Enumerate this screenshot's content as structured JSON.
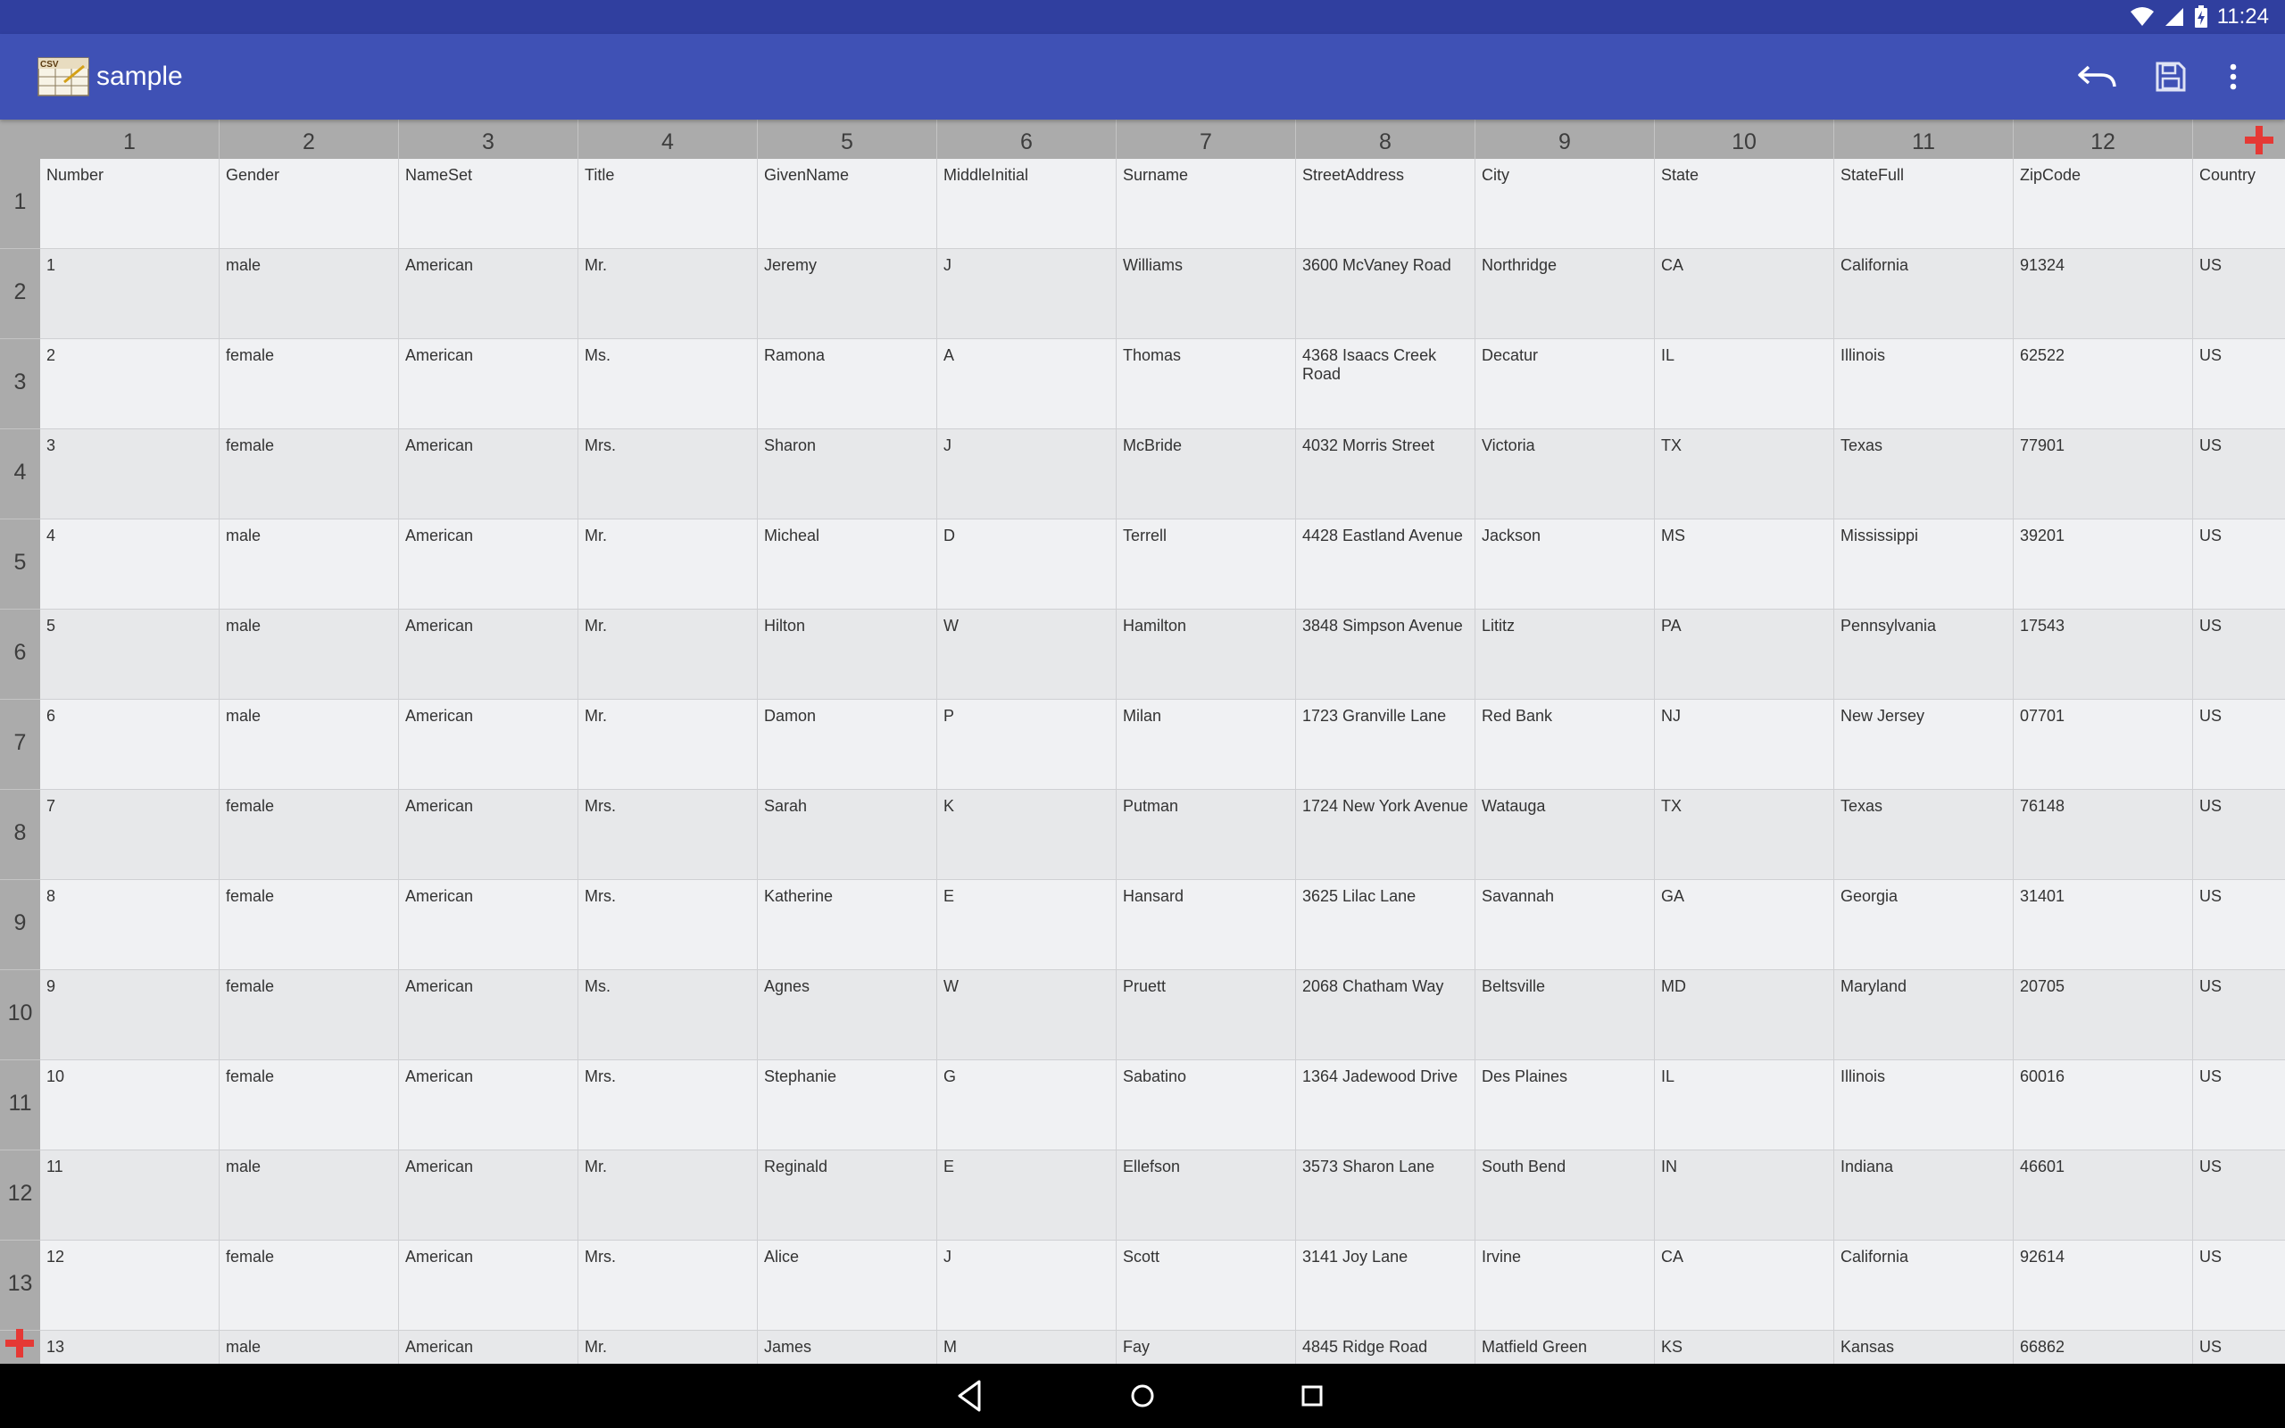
{
  "status_bar": {
    "time": "11:24",
    "icons": [
      "wifi-icon",
      "cell-signal-icon",
      "battery-charging-icon"
    ]
  },
  "app_bar": {
    "icon_text": "CSV",
    "title": "sample",
    "actions": [
      "undo-icon",
      "save-icon",
      "more-vert-icon"
    ]
  },
  "grid": {
    "column_numbers": [
      "1",
      "2",
      "3",
      "4",
      "5",
      "6",
      "7",
      "8",
      "9",
      "10",
      "11",
      "12"
    ],
    "row_numbers": [
      "1",
      "2",
      "3",
      "4",
      "5",
      "6",
      "7",
      "8",
      "9",
      "10",
      "11",
      "12",
      "13"
    ],
    "add_column_icon": "plus-icon",
    "add_row_icon": "plus-icon",
    "rows": [
      [
        "Number",
        "Gender",
        "NameSet",
        "Title",
        "GivenName",
        "MiddleInitial",
        "Surname",
        "StreetAddress",
        "City",
        "State",
        "StateFull",
        "ZipCode",
        "Country"
      ],
      [
        "1",
        "male",
        "American",
        "Mr.",
        "Jeremy",
        "J",
        "Williams",
        "3600 McVaney Road",
        "Northridge",
        "CA",
        "California",
        "91324",
        "US"
      ],
      [
        "2",
        "female",
        "American",
        "Ms.",
        "Ramona",
        "A",
        "Thomas",
        "4368 Isaacs Creek Road",
        "Decatur",
        "IL",
        "Illinois",
        "62522",
        "US"
      ],
      [
        "3",
        "female",
        "American",
        "Mrs.",
        "Sharon",
        "J",
        "McBride",
        "4032 Morris Street",
        "Victoria",
        "TX",
        "Texas",
        "77901",
        "US"
      ],
      [
        "4",
        "male",
        "American",
        "Mr.",
        "Micheal",
        "D",
        "Terrell",
        "4428 Eastland Avenue",
        "Jackson",
        "MS",
        "Mississippi",
        "39201",
        "US"
      ],
      [
        "5",
        "male",
        "American",
        "Mr.",
        "Hilton",
        "W",
        "Hamilton",
        "3848 Simpson Avenue",
        "Lititz",
        "PA",
        "Pennsylvania",
        "17543",
        "US"
      ],
      [
        "6",
        "male",
        "American",
        "Mr.",
        "Damon",
        "P",
        "Milan",
        "1723 Granville Lane",
        "Red Bank",
        "NJ",
        "New Jersey",
        "07701",
        "US"
      ],
      [
        "7",
        "female",
        "American",
        "Mrs.",
        "Sarah",
        "K",
        "Putman",
        "1724 New York Avenue",
        "Watauga",
        "TX",
        "Texas",
        "76148",
        "US"
      ],
      [
        "8",
        "female",
        "American",
        "Mrs.",
        "Katherine",
        "E",
        "Hansard",
        "3625 Lilac Lane",
        "Savannah",
        "GA",
        "Georgia",
        "31401",
        "US"
      ],
      [
        "9",
        "female",
        "American",
        "Ms.",
        "Agnes",
        "W",
        "Pruett",
        "2068 Chatham Way",
        "Beltsville",
        "MD",
        "Maryland",
        "20705",
        "US"
      ],
      [
        "10",
        "female",
        "American",
        "Mrs.",
        "Stephanie",
        "G",
        "Sabatino",
        "1364 Jadewood Drive",
        "Des Plaines",
        "IL",
        "Illinois",
        "60016",
        "US"
      ],
      [
        "11",
        "male",
        "American",
        "Mr.",
        "Reginald",
        "E",
        "Ellefson",
        "3573 Sharon Lane",
        "South Bend",
        "IN",
        "Indiana",
        "46601",
        "US"
      ],
      [
        "12",
        "female",
        "American",
        "Mrs.",
        "Alice",
        "J",
        "Scott",
        "3141 Joy Lane",
        "Irvine",
        "CA",
        "California",
        "92614",
        "US"
      ],
      [
        "13",
        "male",
        "American",
        "Mr.",
        "James",
        "M",
        "Fay",
        "4845 Ridge Road",
        "Matfield Green",
        "KS",
        "Kansas",
        "66862",
        "US"
      ]
    ]
  },
  "nav_bar": {
    "buttons": [
      "back-icon",
      "home-icon",
      "recents-icon"
    ]
  },
  "colors": {
    "status_bar": "#303f9f",
    "app_bar": "#3f51b5",
    "header_gray": "#ababab",
    "add_red": "#e53935"
  }
}
